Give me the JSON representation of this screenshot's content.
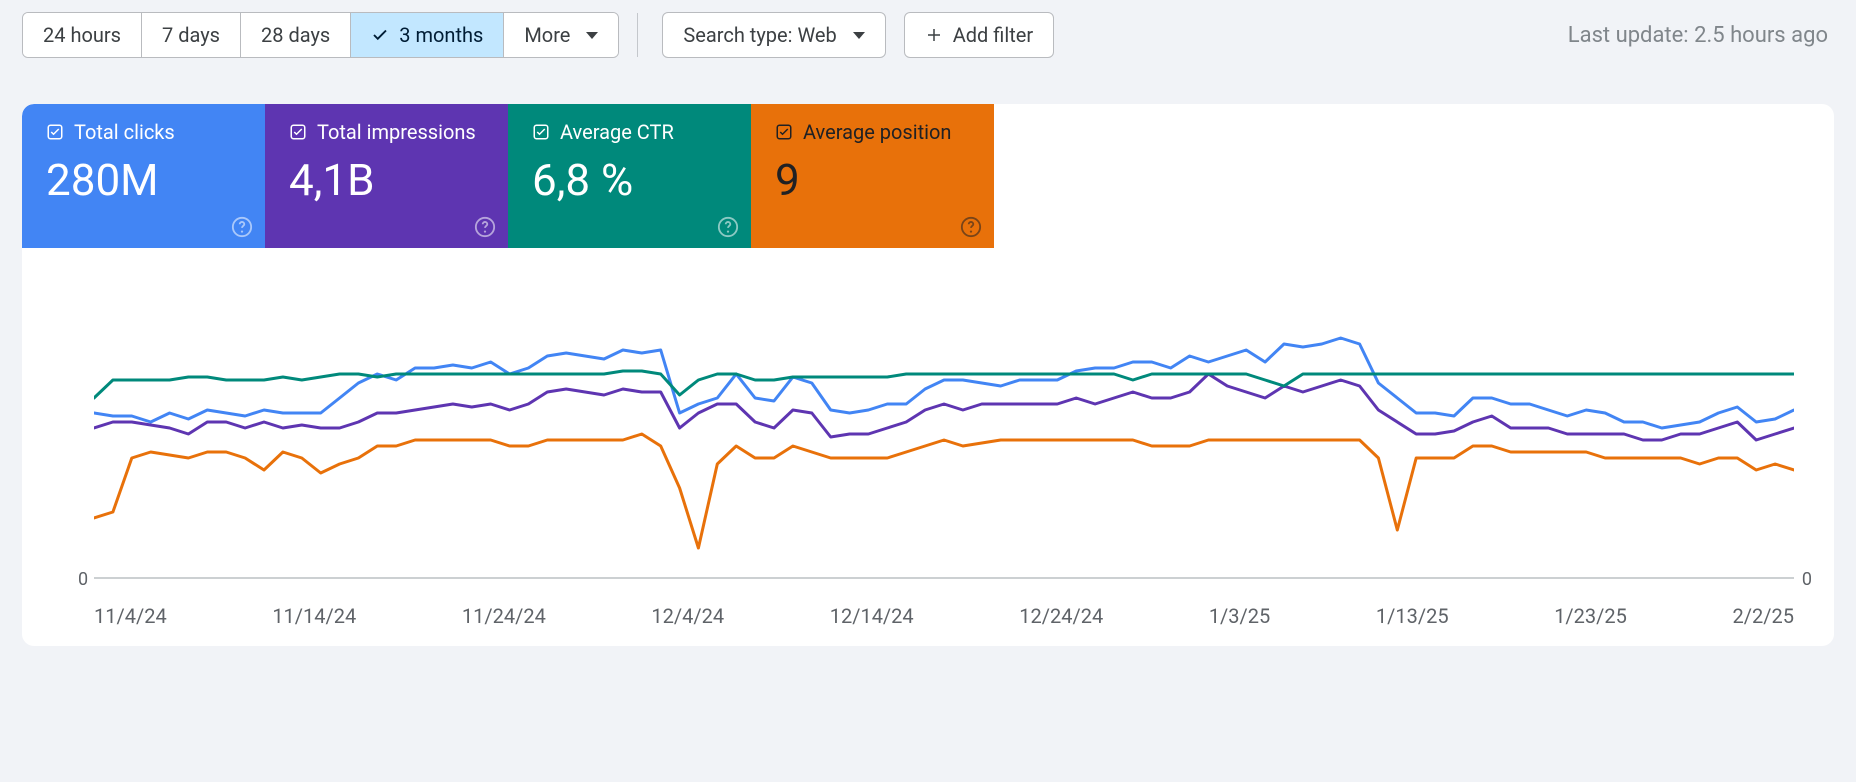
{
  "toolbar": {
    "range_buttons": [
      "24 hours",
      "7 days",
      "28 days",
      "3 months"
    ],
    "range_selected": 3,
    "more_label": "More",
    "search_type_label": "Search type: Web",
    "add_filter_label": "Add filter",
    "last_update": "Last update: 2.5 hours ago"
  },
  "cards": {
    "clicks": {
      "label": "Total clicks",
      "value": "280M"
    },
    "impressions": {
      "label": "Total impressions",
      "value": "4,1B"
    },
    "ctr": {
      "label": "Average CTR",
      "value": "6,8 %"
    },
    "position": {
      "label": "Average position",
      "value": "9"
    }
  },
  "chart_data": {
    "type": "line",
    "x_ticks": [
      "11/4/24",
      "11/14/24",
      "11/24/24",
      "12/4/24",
      "12/14/24",
      "12/24/24",
      "1/3/25",
      "1/13/25",
      "1/23/25",
      "2/2/25"
    ],
    "y_zero_left": "0",
    "y_zero_right": "0",
    "ylim": [
      0,
      100
    ],
    "series": [
      {
        "name": "Total clicks",
        "color": "#4285f4",
        "values": [
          55,
          54,
          54,
          52,
          55,
          53,
          56,
          55,
          54,
          56,
          55,
          55,
          55,
          60,
          65,
          68,
          66,
          70,
          70,
          71,
          70,
          72,
          68,
          70,
          74,
          75,
          74,
          73,
          76,
          75,
          76,
          55,
          58,
          60,
          68,
          60,
          59,
          67,
          65,
          56,
          55,
          56,
          58,
          58,
          63,
          66,
          66,
          65,
          64,
          66,
          66,
          66,
          69,
          70,
          70,
          72,
          72,
          70,
          74,
          72,
          74,
          76,
          72,
          78,
          77,
          78,
          80,
          78,
          65,
          60,
          55,
          55,
          54,
          60,
          60,
          58,
          58,
          56,
          54,
          56,
          55,
          52,
          52,
          50,
          51,
          52,
          55,
          57,
          52,
          53,
          56
        ]
      },
      {
        "name": "Total impressions",
        "color": "#5e35b1",
        "values": [
          50,
          52,
          52,
          51,
          50,
          48,
          52,
          52,
          50,
          52,
          50,
          51,
          50,
          50,
          52,
          55,
          55,
          56,
          57,
          58,
          57,
          58,
          56,
          58,
          62,
          63,
          62,
          61,
          63,
          62,
          62,
          50,
          55,
          58,
          58,
          52,
          50,
          56,
          55,
          47,
          48,
          48,
          50,
          52,
          56,
          58,
          56,
          58,
          58,
          58,
          58,
          58,
          60,
          58,
          60,
          62,
          60,
          60,
          62,
          68,
          64,
          62,
          60,
          64,
          62,
          64,
          66,
          64,
          56,
          52,
          48,
          48,
          49,
          52,
          54,
          50,
          50,
          50,
          48,
          48,
          48,
          48,
          46,
          46,
          48,
          48,
          50,
          52,
          46,
          48,
          50
        ]
      },
      {
        "name": "Average CTR",
        "color": "#00897b",
        "values": [
          60,
          66,
          66,
          66,
          66,
          67,
          67,
          66,
          66,
          66,
          67,
          66,
          67,
          68,
          68,
          67,
          68,
          68,
          68,
          68,
          68,
          68,
          68,
          68,
          68,
          68,
          68,
          68,
          69,
          69,
          68,
          61,
          66,
          68,
          68,
          66,
          66,
          67,
          67,
          67,
          67,
          67,
          67,
          68,
          68,
          68,
          68,
          68,
          68,
          68,
          68,
          68,
          68,
          68,
          68,
          66,
          68,
          68,
          68,
          68,
          68,
          68,
          66,
          64,
          68,
          68,
          68,
          68,
          68,
          68,
          68,
          68,
          68,
          68,
          68,
          68,
          68,
          68,
          68,
          68,
          68,
          68,
          68,
          68,
          68,
          68,
          68,
          68,
          68,
          68,
          68
        ]
      },
      {
        "name": "Average position",
        "color": "#e8710a",
        "values": [
          20,
          22,
          40,
          42,
          41,
          40,
          42,
          42,
          40,
          36,
          42,
          40,
          35,
          38,
          40,
          44,
          44,
          46,
          46,
          46,
          46,
          46,
          44,
          44,
          46,
          46,
          46,
          46,
          46,
          48,
          44,
          30,
          10,
          38,
          44,
          40,
          40,
          44,
          42,
          40,
          40,
          40,
          40,
          42,
          44,
          46,
          44,
          45,
          46,
          46,
          46,
          46,
          46,
          46,
          46,
          46,
          44,
          44,
          44,
          46,
          46,
          46,
          46,
          46,
          46,
          46,
          46,
          46,
          40,
          16,
          40,
          40,
          40,
          44,
          44,
          42,
          42,
          42,
          42,
          42,
          40,
          40,
          40,
          40,
          40,
          38,
          40,
          40,
          36,
          38,
          36
        ]
      }
    ]
  }
}
